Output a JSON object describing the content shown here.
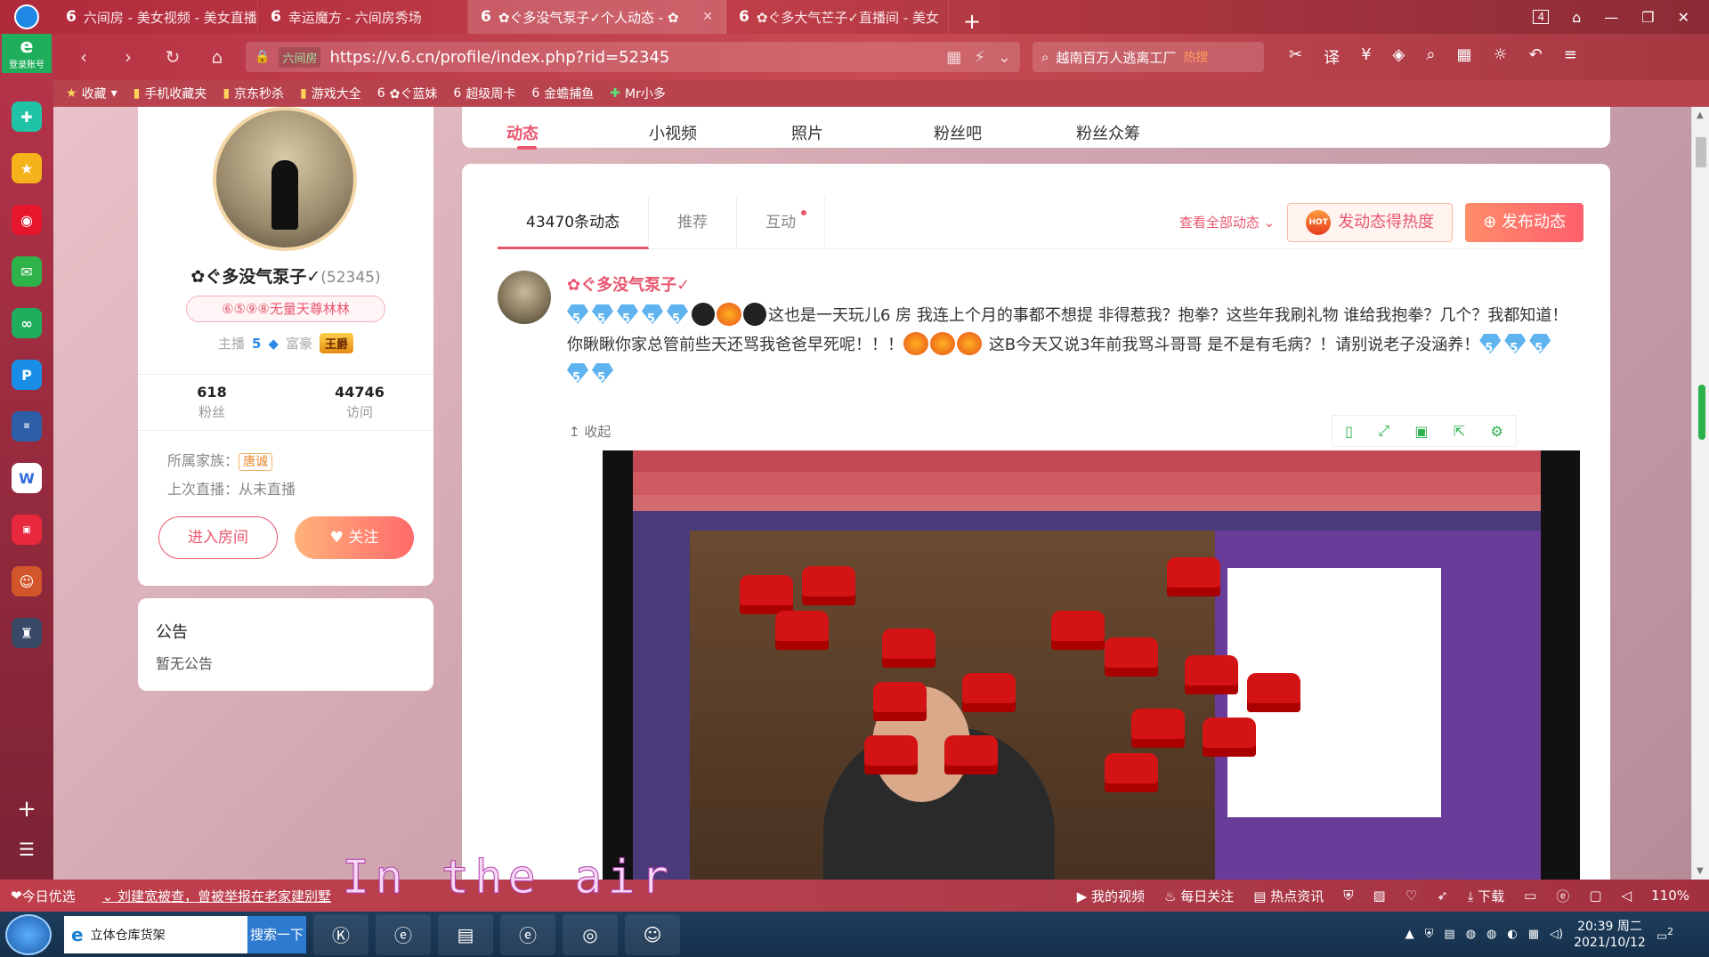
{
  "tabs": [
    {
      "label": "六间房 - 美女视频 - 美女直播",
      "active": false
    },
    {
      "label": "幸运魔方 - 六间房秀场",
      "active": false
    },
    {
      "label": "✿ぐ多没气泵子✓个人动态 - ✿",
      "active": true
    },
    {
      "label": "✿ぐ多大气芒子✓直播间 - 美女",
      "active": false
    }
  ],
  "window_controls": {
    "count": "4"
  },
  "nav": {
    "url": "https://v.6.cn/profile/index.php?rid=52345",
    "site_badge": "六间房",
    "search_text": "越南百万人逃离工厂",
    "search_hot": "热搜"
  },
  "bookmarks": [
    "收藏",
    "手机收藏夹",
    "京东秒杀",
    "游戏大全",
    "✿ぐ蓝妹",
    "超级周卡",
    "金蟾捕鱼",
    "Mr小多"
  ],
  "sidebar": {
    "login_label": "登录账号"
  },
  "topnav": [
    "动态",
    "小视频",
    "照片",
    "粉丝吧",
    "粉丝众筹"
  ],
  "profile": {
    "name": "✿ぐ多没气泵子✓",
    "rid": "(52345)",
    "motto": "⑥⑤⑨⑧无量天尊林林",
    "host_label": "主播",
    "host_level": "5",
    "rich_label": "富豪",
    "rich_badge": "王爵",
    "fans_count": "618",
    "fans_label": "粉丝",
    "visit_count": "44746",
    "visit_label": "访问",
    "family_label": "所属家族：",
    "family_value": "唐诚",
    "last_live": "上次直播：从未直播",
    "enter_button": "进入房间",
    "follow_button": "关注"
  },
  "notice": {
    "title": "公告",
    "content": "暂无公告"
  },
  "feed": {
    "tabs": [
      "43470条动态",
      "推荐",
      "互动"
    ],
    "view_all": "查看全部动态",
    "hot_button": "发动态得热度",
    "hot_icon_text": "HOT",
    "post_button": "发布动态",
    "post": {
      "user": "✿ぐ多没气泵子✓",
      "text_1": "这也是一天玩儿6 房 我连上个月的事都不想提 非得惹我？抱拳？这些年我刷礼物 谁给我抱拳？几个？我都知道！你瞅瞅你家总管前些天还骂我爸爸早死呢！！！",
      "text_2": "这B今天又说3年前我骂斗哥哥 是不是有毛病？！请别说老子没涵养！",
      "collapse": "收起"
    }
  },
  "subtitle": "In the air",
  "statusbar": {
    "news_label": "今日优选",
    "news_item": "刘建宽被查，曾被举报在老家建别墅",
    "items": [
      "我的视频",
      "每日关注",
      "热点资讯",
      "下载",
      "110%"
    ]
  },
  "taskbar": {
    "search_value": "立体仓库货架",
    "search_button": "搜索一下",
    "time": "20:39 周二",
    "date": "2021/10/12",
    "notif": "2"
  }
}
